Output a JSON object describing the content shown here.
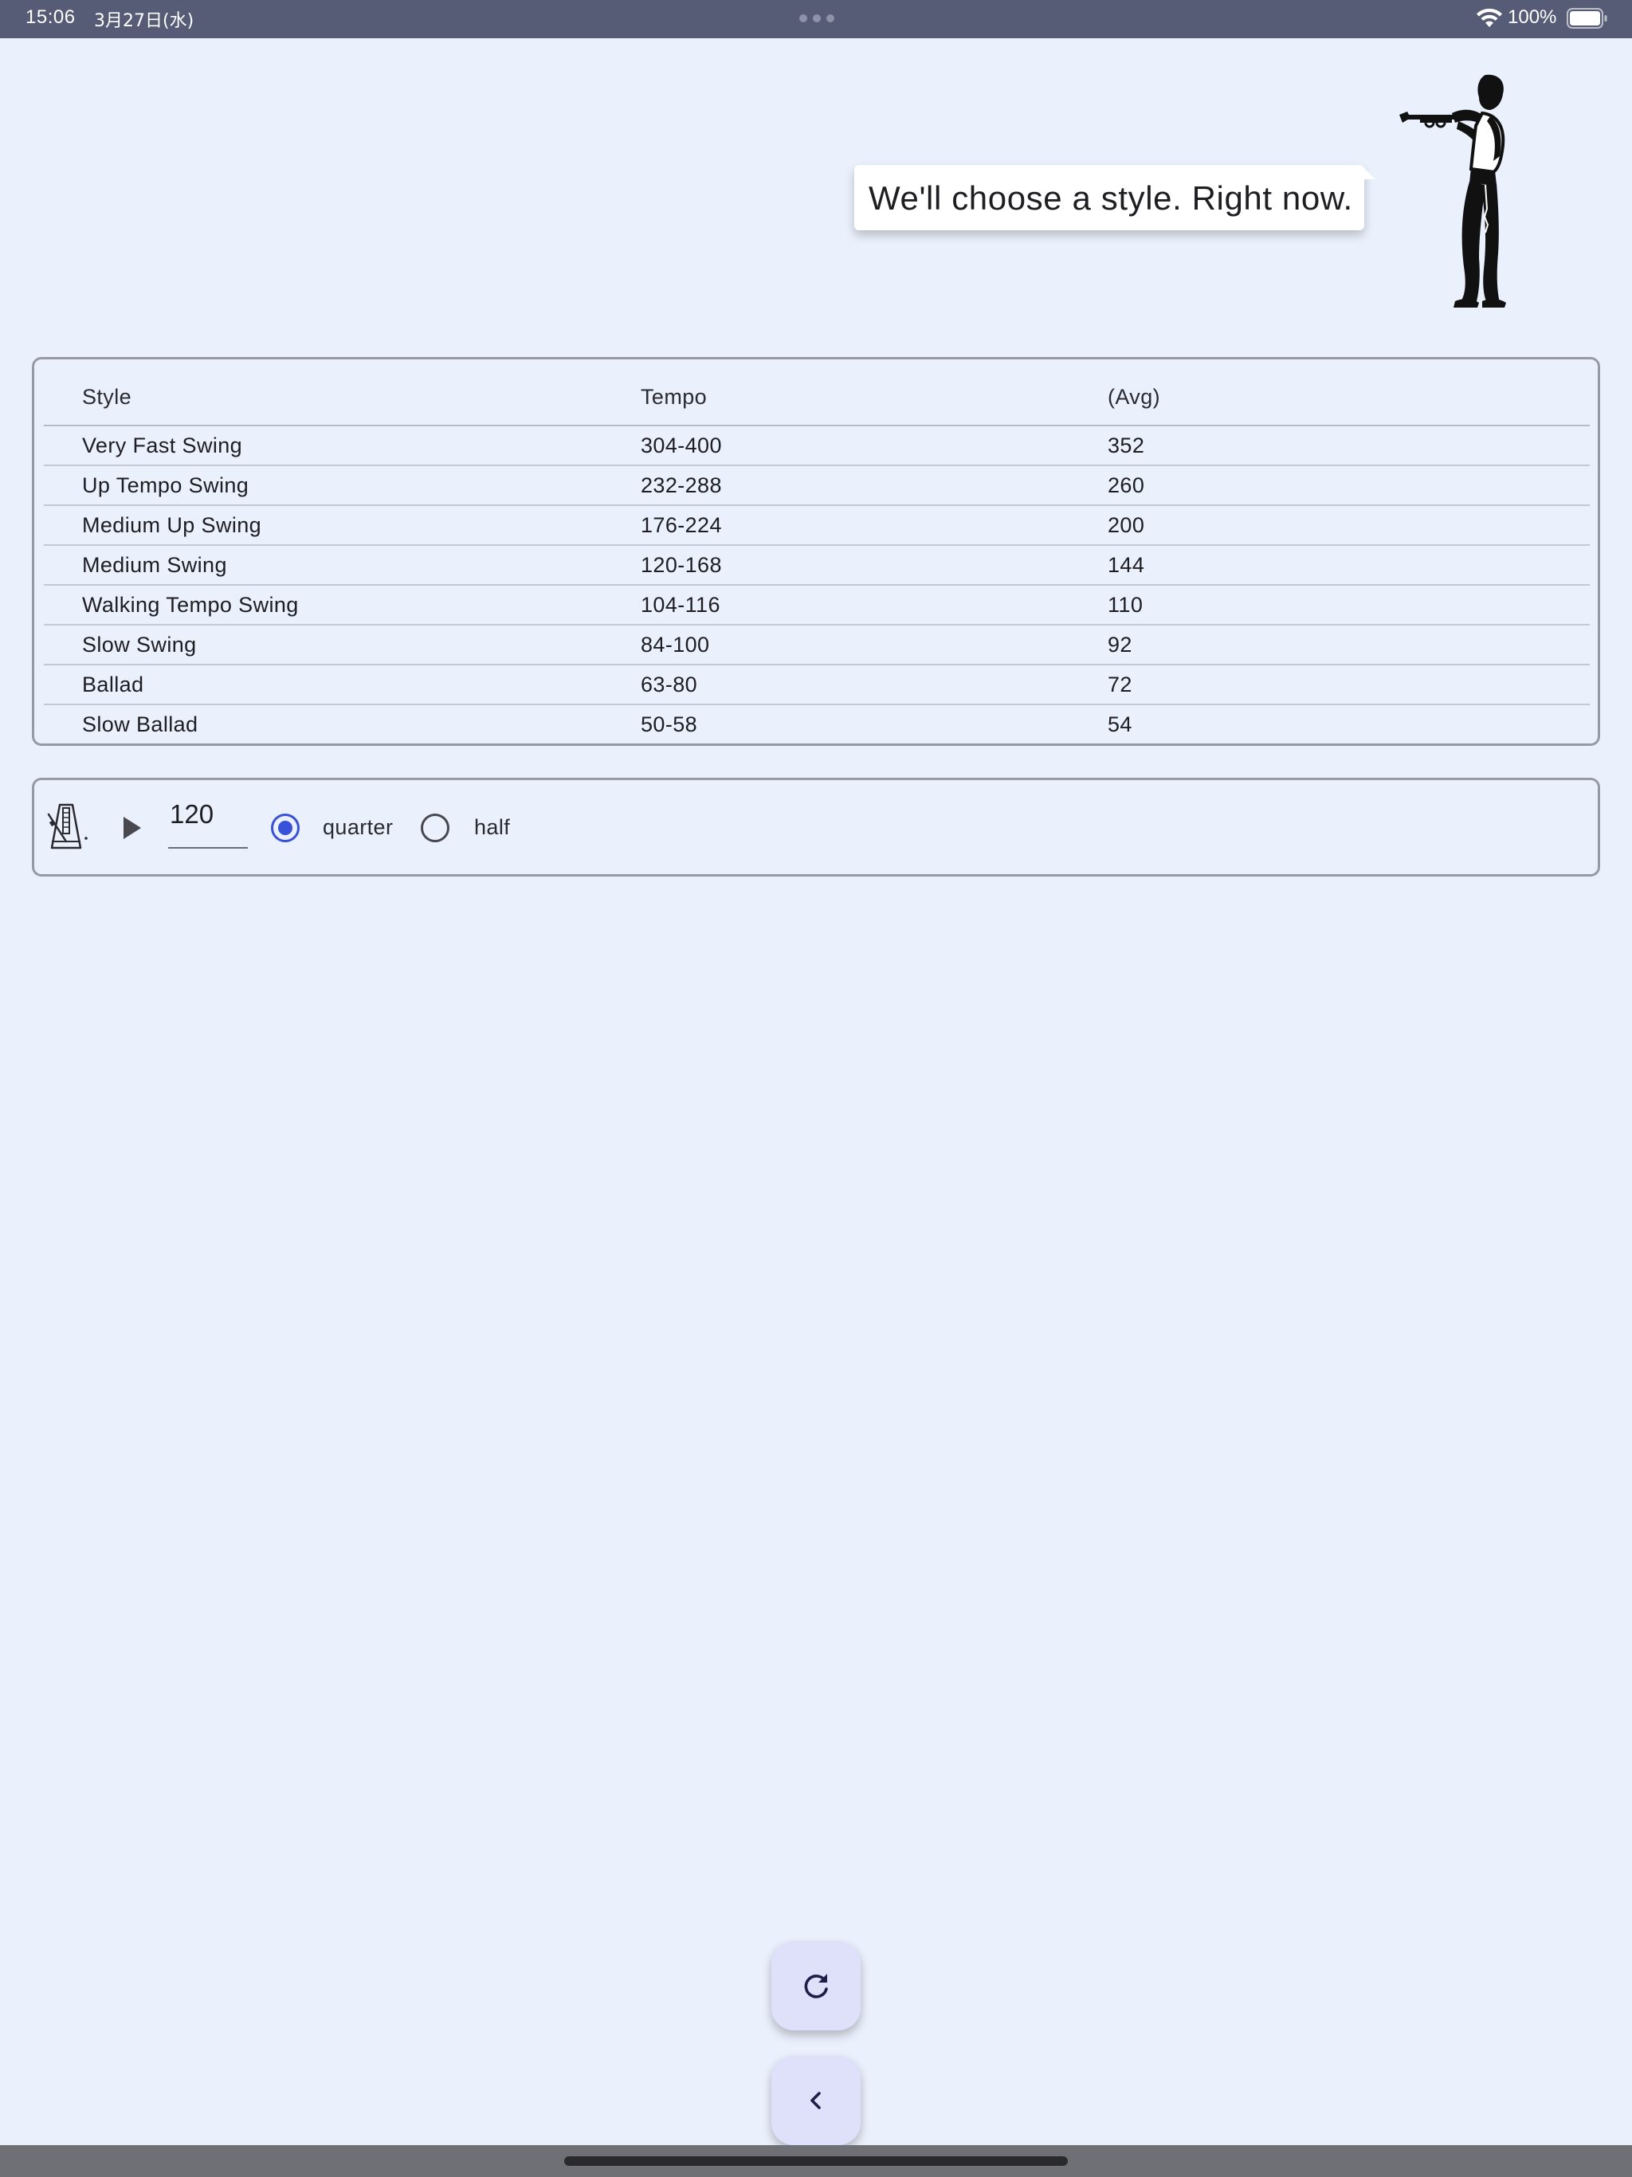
{
  "status_bar": {
    "time": "15:06",
    "date": "3月27日(水)",
    "battery_percent": "100%",
    "battery_level": 1.0
  },
  "header": {
    "speech_bubble": "We'll choose a style. Right now."
  },
  "tempo_table": {
    "columns": [
      "Style",
      "Tempo",
      "(Avg)"
    ],
    "rows": [
      {
        "style": "Very Fast Swing",
        "tempo": "304-400",
        "avg": "352"
      },
      {
        "style": "Up Tempo Swing",
        "tempo": "232-288",
        "avg": "260"
      },
      {
        "style": "Medium Up Swing",
        "tempo": "176-224",
        "avg": "200"
      },
      {
        "style": "Medium Swing",
        "tempo": "120-168",
        "avg": "144"
      },
      {
        "style": "Walking Tempo Swing",
        "tempo": "104-116",
        "avg": "110"
      },
      {
        "style": "Slow Swing",
        "tempo": "84-100",
        "avg": "92"
      },
      {
        "style": "Ballad",
        "tempo": "63-80",
        "avg": "72"
      },
      {
        "style": "Slow Ballad",
        "tempo": "50-58",
        "avg": "54"
      }
    ]
  },
  "metronome": {
    "bpm_value": "120",
    "beat_options": [
      {
        "label": "quarter",
        "selected": true
      },
      {
        "label": "half",
        "selected": false
      }
    ]
  },
  "colors": {
    "background": "#eaf0fc",
    "status_bar": "#575c76",
    "accent_radio": "#3751d8",
    "fab_background": "#dfe0fa"
  },
  "icons": {
    "metronome": "metronome-icon",
    "play": "play-icon",
    "refresh": "refresh-icon",
    "back": "chevron-left-icon",
    "wifi": "wifi-icon",
    "battery": "battery-icon"
  }
}
